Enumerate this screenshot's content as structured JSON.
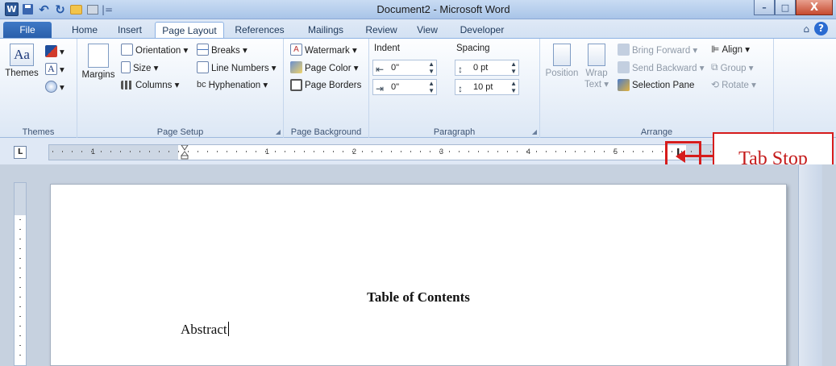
{
  "window": {
    "title": "Document2 - Microsoft Word",
    "app_icon": "W",
    "buttons": {
      "minimize": "–",
      "maximize": "□",
      "close": "X"
    }
  },
  "quick_access": {
    "separator": "|="
  },
  "tabs": [
    {
      "label": "File"
    },
    {
      "label": "Home"
    },
    {
      "label": "Insert"
    },
    {
      "label": "Page Layout"
    },
    {
      "label": "References"
    },
    {
      "label": "Mailings"
    },
    {
      "label": "Review"
    },
    {
      "label": "View"
    },
    {
      "label": "Developer"
    }
  ],
  "ribbon": {
    "themes": {
      "button": "Themes",
      "group_label": "Themes"
    },
    "page_setup": {
      "margins": "Margins",
      "orientation": "Orientation ▾",
      "size": "Size ▾",
      "columns": "Columns ▾",
      "breaks": "Breaks ▾",
      "line_numbers": "Line Numbers ▾",
      "hyphenation": "Hyphenation ▾",
      "group_label": "Page Setup"
    },
    "page_background": {
      "watermark": "Watermark ▾",
      "page_color": "Page Color ▾",
      "page_borders": "Page Borders",
      "group_label": "Page Background"
    },
    "paragraph": {
      "indent_label": "Indent",
      "indent_left": "0\"",
      "indent_right": "0\"",
      "spacing_label": "Spacing",
      "spacing_before": "0 pt",
      "spacing_after": "10 pt",
      "group_label": "Paragraph"
    },
    "arrange": {
      "position": "Position",
      "wrap_text": "Wrap Text ▾",
      "bring_forward": "Bring Forward ▾",
      "send_backward": "Send Backward ▾",
      "selection_pane": "Selection Pane",
      "align": "Align ▾",
      "group": "Group ▾",
      "rotate": "Rotate ▾",
      "group_label": "Arrange"
    }
  },
  "ruler": {
    "corner": "L",
    "numbers": [
      "1",
      "1",
      "2",
      "3",
      "4",
      "5"
    ]
  },
  "callout": {
    "label": "Tab Stop"
  },
  "document": {
    "heading": "Table of Contents",
    "line1": "Abstract"
  }
}
